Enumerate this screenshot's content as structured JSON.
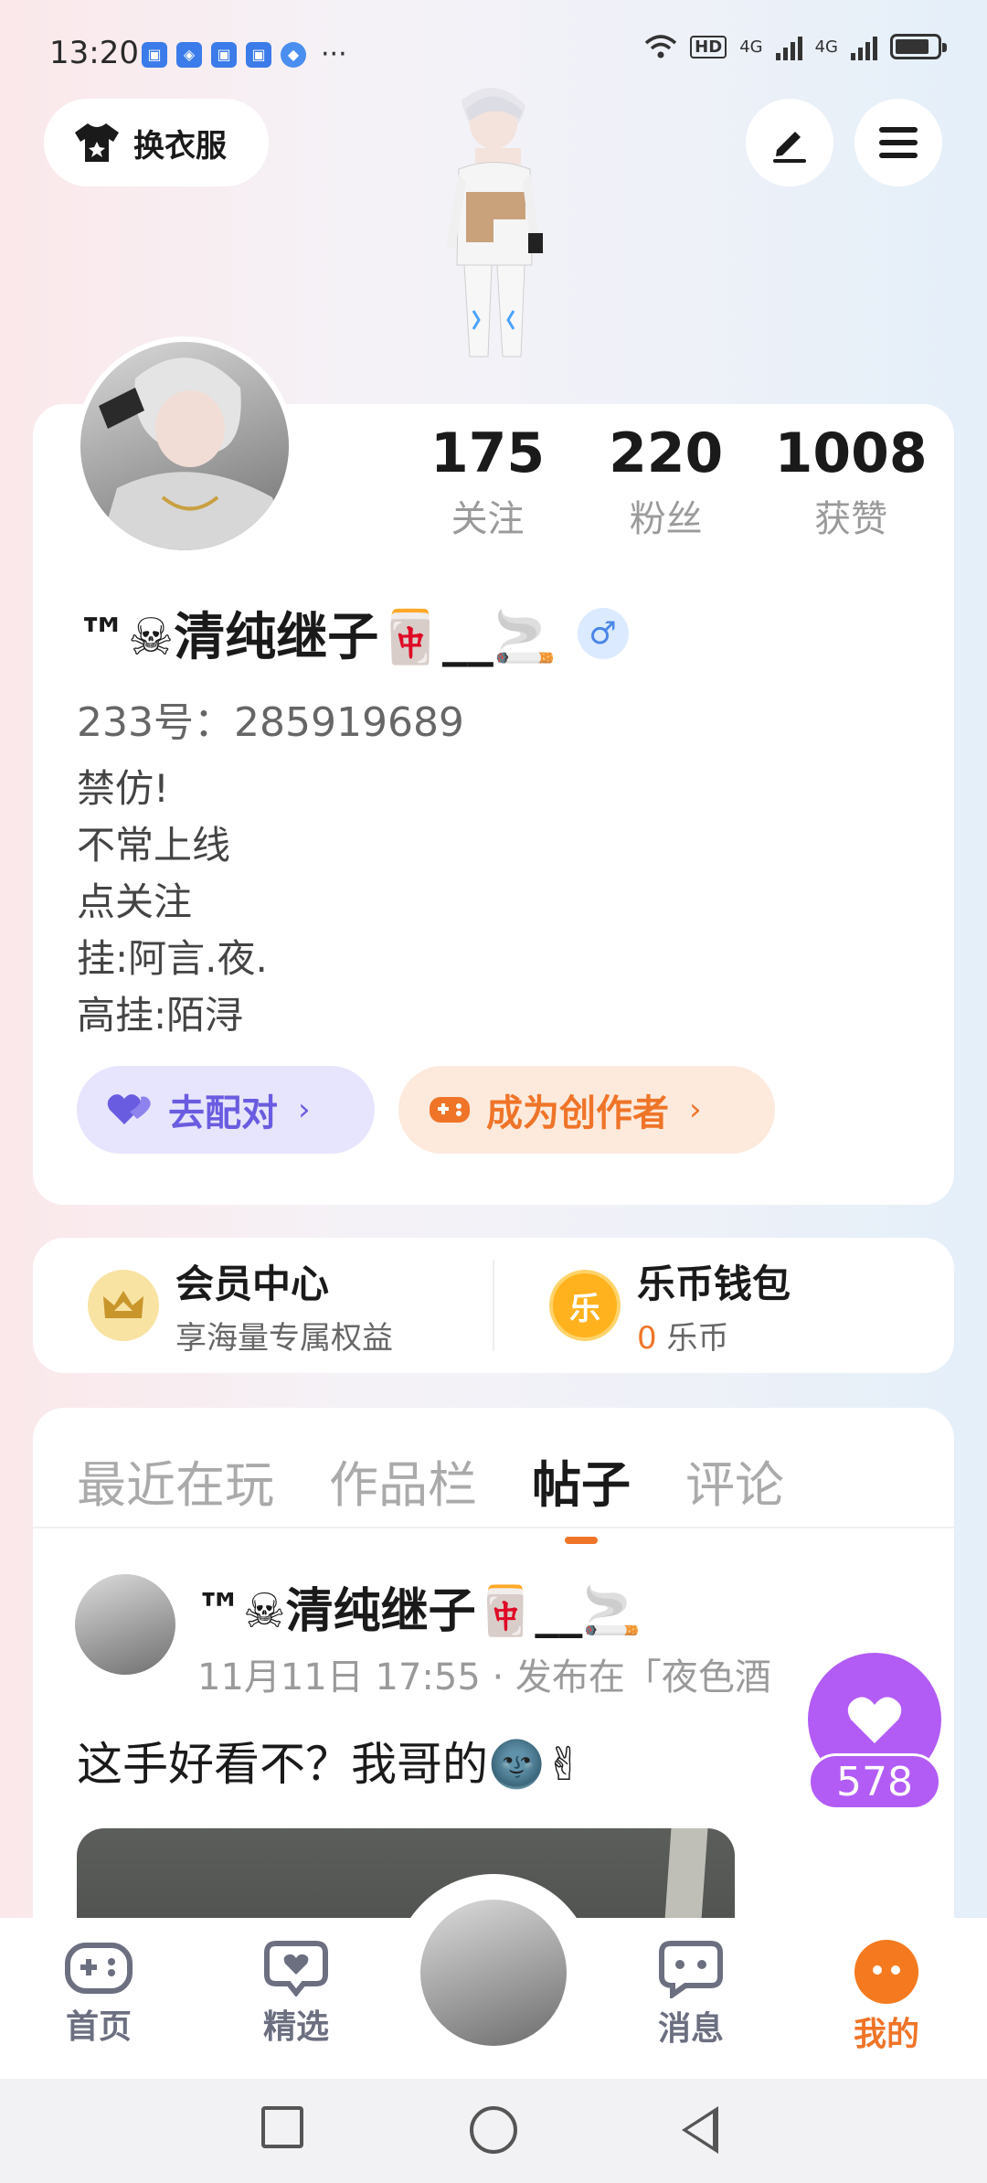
{
  "status_bar": {
    "time": "13:20",
    "more": "···",
    "hd": "HD",
    "net1": "4G",
    "net2": "4G"
  },
  "top": {
    "outfit_label": "换衣服"
  },
  "profile": {
    "stats": [
      {
        "num": "175",
        "label": "关注"
      },
      {
        "num": "220",
        "label": "粉丝"
      },
      {
        "num": "1008",
        "label": "获赞"
      }
    ],
    "nickname": "™☠清纯继子🀄__🚬",
    "gender_symbol": "♂",
    "uid": "233号：285919689",
    "bio": [
      "禁仿!",
      "不常上线",
      "点关注",
      "挂:阿言.夜.",
      "高挂:陌浔"
    ],
    "match_label": "去配对",
    "creator_label": "成为创作者",
    "arrow": "›"
  },
  "member": {
    "vip_title": "会员中心",
    "vip_sub": "享海量专属权益",
    "wallet_title": "乐币钱包",
    "wallet_amount": "0",
    "wallet_unit": "乐币",
    "coin_glyph": "乐"
  },
  "feed": {
    "tabs": [
      "最近在玩",
      "作品栏",
      "帖子",
      "评论"
    ],
    "active_tab": "帖子",
    "post": {
      "author": "™☠清纯继子🀄__🚬",
      "meta": "11月11日 17:55 · 发布在「夜色酒",
      "text": "这手好看不？我哥的🌚✌"
    }
  },
  "like": {
    "count": "578"
  },
  "bottom_nav": {
    "items": [
      {
        "label": "首页",
        "icon": "gamepad-icon"
      },
      {
        "label": "精选",
        "icon": "heart-chat-icon"
      },
      {
        "label": "消息",
        "icon": "message-icon"
      },
      {
        "label": "我的",
        "icon": "mine-icon"
      }
    ],
    "active": "我的"
  },
  "colors": {
    "accent": "#f07428",
    "match": "#6a5ce0",
    "like": "#b25cf5"
  }
}
